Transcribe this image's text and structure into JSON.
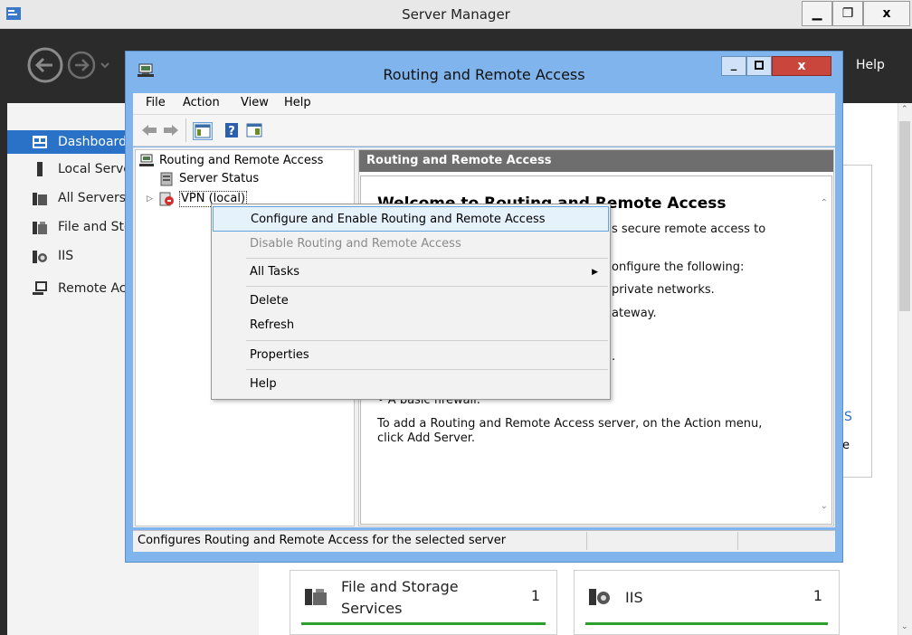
{
  "server_manager": {
    "title": "Server Manager",
    "help_menu": "Help",
    "nav": [
      {
        "label": "Dashboard"
      },
      {
        "label": "Local Server"
      },
      {
        "label": "All Servers"
      },
      {
        "label": "File and Storage Services"
      },
      {
        "label": "IIS"
      },
      {
        "label": "Remote Access"
      }
    ],
    "tiles": [
      {
        "title_line1": "File and Storage",
        "title_line2": "Services",
        "count": "1"
      },
      {
        "title_line1": "IIS",
        "title_line2": "",
        "count": "1"
      }
    ],
    "right_panel_fragments": [
      "S",
      "e"
    ]
  },
  "rras": {
    "title": "Routing and Remote Access",
    "menu": [
      "File",
      "Action",
      "View",
      "Help"
    ],
    "tree": {
      "root": "Routing and Remote Access",
      "server_status": "Server Status",
      "server_node": "VPN (local)"
    },
    "content": {
      "header": "Routing and Remote Access",
      "heading": "Welcome to Routing and Remote Access",
      "line1": "s secure remote access to",
      "line2": "onfigure the following:",
      "line3": "private networks.",
      "line4": "ateway.",
      "line5": ".",
      "bullet_firewall": "• A basic firewall.",
      "add_server_line1": "To add a Routing and Remote Access server, on the Action menu,",
      "add_server_line2": "click Add Server."
    },
    "status_text": "Configures Routing and Remote Access for the selected server"
  },
  "context_menu": {
    "configure": "Configure and Enable Routing and Remote Access",
    "disable": "Disable Routing and Remote Access",
    "all_tasks": "All Tasks",
    "delete": "Delete",
    "refresh": "Refresh",
    "properties": "Properties",
    "help": "Help"
  },
  "colors": {
    "accent": "#2a72c8",
    "window_frame": "#7fb5ec",
    "close_button": "#c9463d",
    "status_ok": "#2ca02c"
  }
}
